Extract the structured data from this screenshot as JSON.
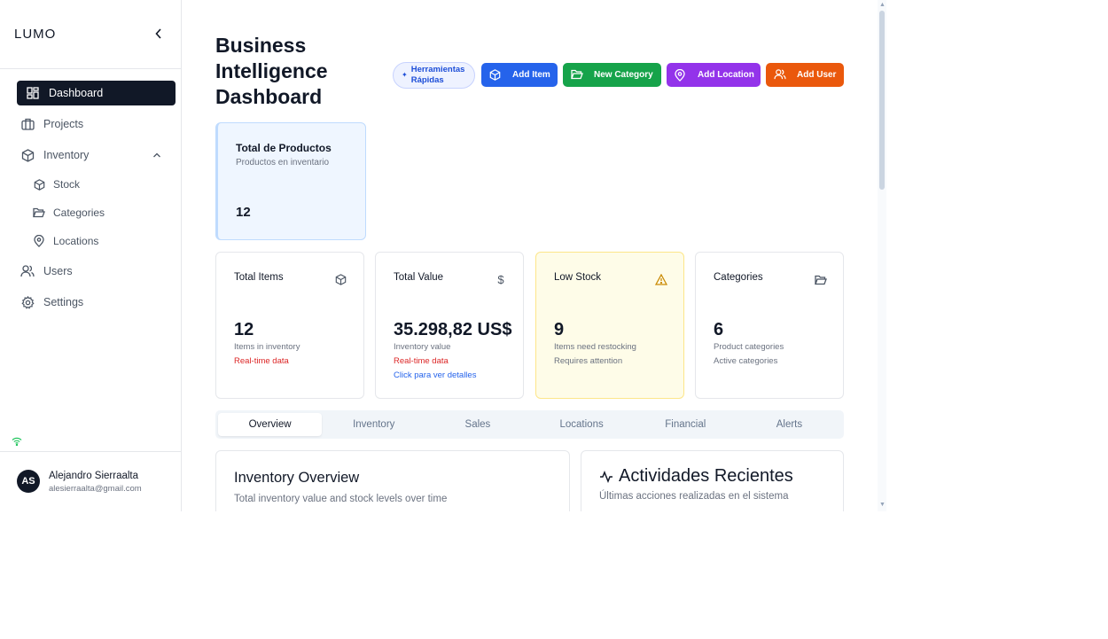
{
  "sidebar": {
    "logo": "LUMO",
    "items": [
      {
        "label": "Dashboard"
      },
      {
        "label": "Projects"
      },
      {
        "label": "Inventory"
      },
      {
        "label": "Users"
      },
      {
        "label": "Settings"
      }
    ],
    "inventory_sub": [
      {
        "label": "Stock"
      },
      {
        "label": "Categories"
      },
      {
        "label": "Locations"
      }
    ],
    "user": {
      "initials": "AS",
      "name": "Alejandro Sierraalta",
      "email": "alesierraalta@gmail.com"
    }
  },
  "header": {
    "title": "Business Intelligence Dashboard",
    "quick_badge_line1": "Herramientas",
    "quick_badge_line2": "Rápidas",
    "buttons": {
      "add_item": "Add Item",
      "new_category": "New Category",
      "add_location": "Add Location",
      "add_user": "Add User"
    }
  },
  "total_products": {
    "title": "Total de Productos",
    "subtitle": "Productos en inventario",
    "value": "12"
  },
  "stats": {
    "total_items": {
      "title": "Total Items",
      "value": "12",
      "line1": "Items in inventory",
      "line2": "Real-time data"
    },
    "total_value": {
      "title": "Total Value",
      "value": "35.298,82 US$",
      "line1": "Inventory value",
      "line2": "Real-time data",
      "line3": "Click para ver detalles"
    },
    "low_stock": {
      "title": "Low Stock",
      "value": "9",
      "line1": "Items need restocking",
      "line2": "Requires attention"
    },
    "categories": {
      "title": "Categories",
      "value": "6",
      "line1": "Product categories",
      "line2": "Active categories"
    }
  },
  "tabs": [
    "Overview",
    "Inventory",
    "Sales",
    "Locations",
    "Financial",
    "Alerts"
  ],
  "panels": {
    "inventory_overview": {
      "title": "Inventory Overview",
      "desc": "Total inventory value and stock levels over time"
    },
    "recent_activity": {
      "title": "Actividades Recientes",
      "desc": "Últimas acciones realizadas en el sistema"
    }
  },
  "colors": {
    "accent_blue": "#2563eb",
    "green": "#16a34a",
    "purple": "#9333ea",
    "orange": "#ea580c",
    "warning": "#ca8a04"
  }
}
